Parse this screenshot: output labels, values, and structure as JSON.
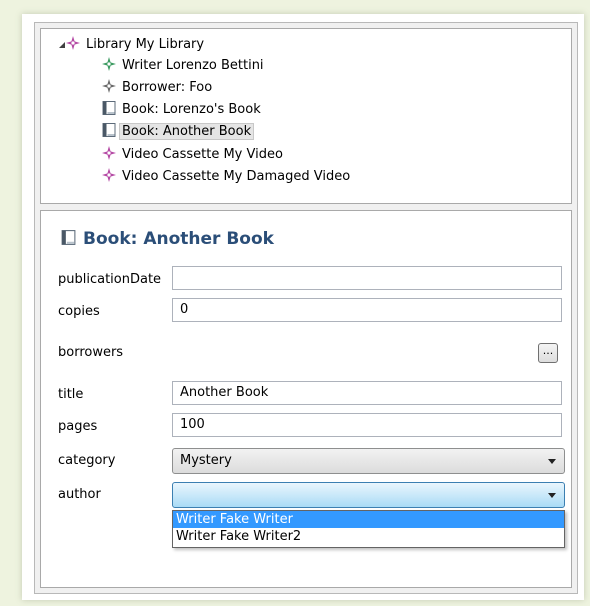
{
  "tree": {
    "items": [
      {
        "label": "Library My Library",
        "icon": "library-icon",
        "expanded": true
      },
      {
        "label": "Writer Lorenzo Bettini",
        "icon": "writer-icon"
      },
      {
        "label": "Borrower: Foo",
        "icon": "borrower-icon"
      },
      {
        "label": "Book: Lorenzo's Book",
        "icon": "book-icon"
      },
      {
        "label": "Book: Another Book",
        "icon": "book-icon",
        "selected": true
      },
      {
        "label": "Video Cassette My Video",
        "icon": "video-cassette-icon"
      },
      {
        "label": "Video Cassette My Damaged Video",
        "icon": "video-cassette-icon"
      }
    ]
  },
  "detail": {
    "title": "Book: Another Book",
    "fields": {
      "publicationDate": {
        "label": "publicationDate",
        "value": ""
      },
      "copies": {
        "label": "copies",
        "value": "0"
      },
      "borrowers": {
        "label": "borrowers",
        "button_label": "..."
      },
      "title": {
        "label": "title",
        "value": "Another Book"
      },
      "pages": {
        "label": "pages",
        "value": "100"
      },
      "category": {
        "label": "category",
        "value": "Mystery"
      },
      "author": {
        "label": "author",
        "value": ""
      }
    },
    "author_options": [
      {
        "label": "Writer Fake Writer",
        "highlighted": true
      },
      {
        "label": "Writer Fake Writer2",
        "highlighted": false
      }
    ]
  },
  "colors": {
    "page_background": "#eef3df",
    "title_text": "#2b4e78",
    "library_icon": "#b54aa5",
    "writer_icon": "#3d9b62",
    "video_icon": "#b54aa5",
    "dropdown_highlight": "#3399ff"
  }
}
